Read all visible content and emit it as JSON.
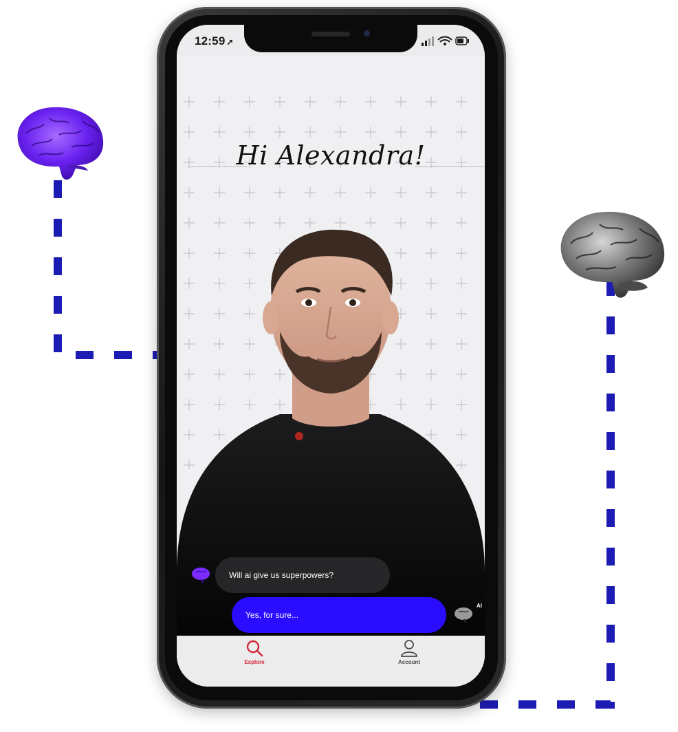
{
  "status_bar": {
    "time": "12:59",
    "location_arrow": "➚"
  },
  "greeting": "Hi Alexandra!",
  "chat": {
    "question": "Will ai give us superpowers?",
    "answer": "Yes, for sure...",
    "ai_tag": "AI"
  },
  "tabs": [
    {
      "label": "Explore",
      "icon": "search-icon",
      "active": true
    },
    {
      "label": "Account",
      "icon": "user-icon",
      "active": false
    }
  ],
  "colors": {
    "connector": "#1c1cb4",
    "answer_bubble": "#2a0cff",
    "question_bubble": "#262628",
    "active_tab": "#d4293c",
    "brain_left": "#7a2cff",
    "brain_right": "#6e6e6e"
  }
}
